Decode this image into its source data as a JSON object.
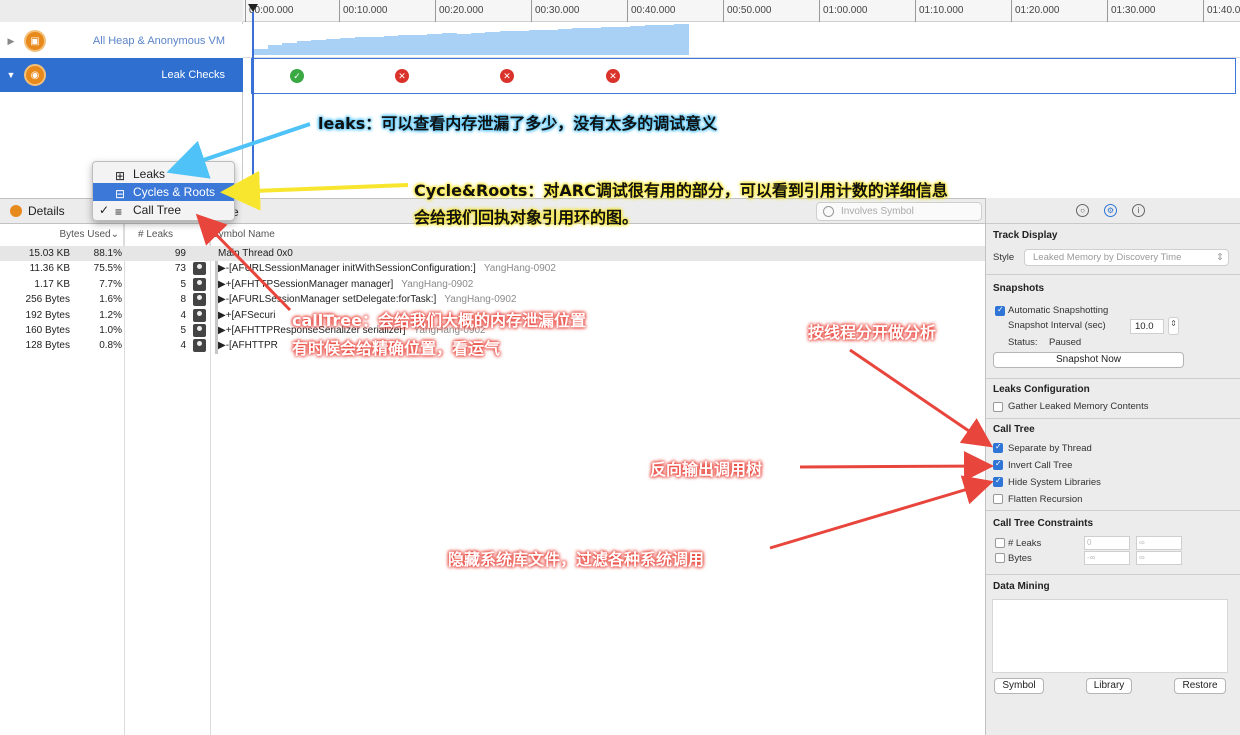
{
  "ruler": {
    "ticks": [
      "00:00.000",
      "00:10.000",
      "00:20.000",
      "00:30.000",
      "00:40.000",
      "00:50.000",
      "01:00.000",
      "01:10.000",
      "01:20.000",
      "01:30.000",
      "01:40.0"
    ]
  },
  "tracks": [
    {
      "label": "All Heap & Anonymous VM",
      "icon": "allocations-icon",
      "expanded": false
    },
    {
      "label": "Leak Checks",
      "icon": "leaks-icon",
      "expanded": true,
      "selected": true
    }
  ],
  "leak_checks": [
    {
      "status": "ok"
    },
    {
      "status": "leak"
    },
    {
      "status": "leak"
    },
    {
      "status": "leak"
    }
  ],
  "view_menu": {
    "items": [
      {
        "label": "Leaks",
        "icon": "table-icon",
        "checked": false,
        "highlighted": false
      },
      {
        "label": "Cycles & Roots",
        "icon": "graph-icon",
        "checked": false,
        "highlighted": true
      },
      {
        "label": "Call Tree",
        "icon": "list-icon",
        "checked": true,
        "highlighted": false
      }
    ],
    "check_glyph": "✓"
  },
  "details_bar": {
    "label": "Details",
    "trailing": "e",
    "search_placeholder": "Involves Symbol"
  },
  "table": {
    "headers": {
      "bytes_used": "Bytes Used",
      "sort_glyph": "⌄",
      "leaks": "# Leaks",
      "symbol": "Symbol Name"
    },
    "rows": [
      {
        "bytes": "15.03 KB",
        "pct": "88.1%",
        "leaks": "99",
        "symbol": "Main Thread  0x0",
        "lib": "",
        "person": false
      },
      {
        "bytes": "11.36 KB",
        "pct": "75.5%",
        "leaks": "73",
        "symbol": "▶-[AFURLSessionManager initWithSessionConfiguration:]",
        "lib": "YangHang-0902",
        "person": true
      },
      {
        "bytes": "1.17 KB",
        "pct": "7.7%",
        "leaks": "5",
        "symbol": "▶+[AFHTTPSessionManager manager]",
        "lib": "YangHang-0902",
        "person": true
      },
      {
        "bytes": "256 Bytes",
        "pct": "1.6%",
        "leaks": "8",
        "symbol": "▶-[AFURLSessionManager setDelegate:forTask:]",
        "lib": "YangHang-0902",
        "person": true
      },
      {
        "bytes": "192 Bytes",
        "pct": "1.2%",
        "leaks": "4",
        "symbol": "▶+[AFSecuri",
        "lib": "",
        "person": true
      },
      {
        "bytes": "160 Bytes",
        "pct": "1.0%",
        "leaks": "5",
        "symbol": "▶+[AFHTTPResponseSerializer serializer]",
        "lib": "YangHang-0902",
        "person": true
      },
      {
        "bytes": "128 Bytes",
        "pct": "0.8%",
        "leaks": "4",
        "symbol": "▶-[AFHTTPR",
        "lib": "",
        "person": true
      }
    ]
  },
  "inspector": {
    "tabs": [
      "record-settings-icon",
      "display-settings-icon",
      "extended-detail-icon"
    ],
    "active_tab": 1,
    "track_display": {
      "title": "Track Display",
      "style_label": "Style",
      "style_value": "Leaked Memory by Discovery Time"
    },
    "snapshots": {
      "title": "Snapshots",
      "auto_label": "Automatic Snapshotting",
      "auto_checked": true,
      "interval_label": "Snapshot Interval (sec)",
      "interval_value": "10.0",
      "status_label": "Status:",
      "status_value": "Paused",
      "button": "Snapshot Now"
    },
    "leaks_config": {
      "title": "Leaks Configuration",
      "gather_label": "Gather Leaked Memory Contents",
      "gather_checked": false
    },
    "call_tree": {
      "title": "Call Tree",
      "options": [
        {
          "label": "Separate by Thread",
          "checked": true
        },
        {
          "label": "Invert Call Tree",
          "checked": true
        },
        {
          "label": "Hide System Libraries",
          "checked": true
        },
        {
          "label": "Flatten Recursion",
          "checked": false
        }
      ]
    },
    "constraints": {
      "title": "Call Tree Constraints",
      "leaks_label": "# Leaks",
      "bytes_label": "Bytes",
      "leaks_min": "0",
      "leaks_max": "∞",
      "bytes_min": "-∞",
      "bytes_max": "∞"
    },
    "data_mining": {
      "title": "Data Mining",
      "buttons": [
        "Symbol",
        "Library",
        "Restore"
      ]
    }
  },
  "annotations": {
    "leaks": "leaks：可以查看内存泄漏了多少，没有太多的调试意义",
    "cycles_line1": "Cycle&Roots：对ARC调试很有用的部分，可以看到引用计数的详细信息",
    "cycles_line2": "会给我们回执对象引用环的图。",
    "calltree_line1": "callTree：会给我们大概的内存泄漏位置",
    "calltree_line2": "有时候会给精确位置，看运气",
    "separate": "按线程分开做分析",
    "invert": "反向输出调用树",
    "hide": "隐藏系统库文件，过滤各种系统调用"
  },
  "colors": {
    "selection": "#2f6fd0",
    "heap": "#a9d0f5",
    "leak": "#d9332b",
    "ok": "#3aa843",
    "annotation_blue": "#4fc3f7",
    "annotation_yellow": "#f7e52e",
    "annotation_red": "#e8453c"
  }
}
